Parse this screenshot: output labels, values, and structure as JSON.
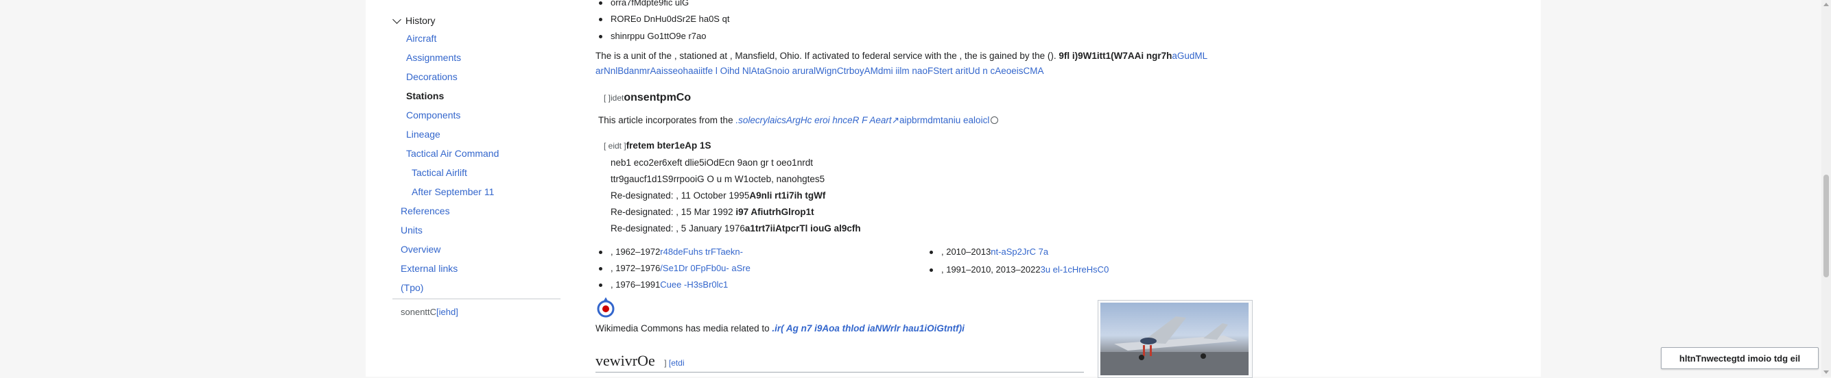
{
  "toc": {
    "history_label": "History",
    "items": [
      {
        "label": "Aircraft"
      },
      {
        "label": "Assignments"
      },
      {
        "label": "Decorations"
      },
      {
        "label": "Stations"
      },
      {
        "label": "Components"
      },
      {
        "label": "Lineage"
      },
      {
        "label": "Tactical Air Command"
      },
      {
        "label": "Tactical Airlift"
      },
      {
        "label": "After September 11"
      },
      {
        "label": "References"
      },
      {
        "label": "Units"
      },
      {
        "label": "Overview"
      },
      {
        "label": "External links"
      },
      {
        "label": "(Tpo)"
      }
    ],
    "footer_text": "sonenttC",
    "footer_link": "[iehd]"
  },
  "top_bullets": [
    "orra7fMdpte9fic ulG",
    "ROREo DnHu0dSr2E ha0S qt",
    "shinrppu Go1ttO9e r7ao"
  ],
  "intro": {
    "text": "The is a unit of the , stationed at , Mansfield, Ohio. If activated to federal service with the , the is gained by the ().",
    "bold": "9fl i)9W1itt1(W7AAi ngr7h",
    "link1": "aGudML",
    "line2": "arNnlBdanmrAaisseohaaiitfe l Oihd NlAtaGnoio aruralWignCtrboyAMdmi iilm naoFStert aritUd n cAeoeisCMA"
  },
  "section3": {
    "edit": "[ ]idet",
    "title": "onsentpmCo",
    "incorporates": "This article incorporates from the",
    "source_link": ".solecrylaicsArgHc eroi hnceR F Aeart",
    "source_rest": "aipbrmdmtaniu ealoicl"
  },
  "section4": {
    "edit": "[ eidt ]",
    "title": "fretem bter1eAp 1S",
    "lines": [
      {
        "text": "neb1 eco2er6xeft dlie5iOdEcn 9aon gr t oeo1nrdt",
        "bold": ""
      },
      {
        "text": "ttr9gaucf1d1S9rrpooiG O u m W1octeb, nanohgtes5",
        "bold": ""
      },
      {
        "text": "Re-designated: , 11 October 1995",
        "bold": "A9nli rt1i7ih tgWf"
      },
      {
        "text": "Re-designated: , 15 Mar 1992 ",
        "bold": "i97 AfiutrhGlrop1t"
      },
      {
        "text": "Re-designated: , 5 January 1976",
        "bold": "a1trt7iiAtpcrTl iouG al9cfh"
      }
    ]
  },
  "assignments_left": [
    {
      "text": ", 1962–1972",
      "link": "r48deFuhs trFTaekn-"
    },
    {
      "text": ", 1972–1976",
      "link": "/Se1Dr 0FpFb0u- aSre"
    },
    {
      "text": ", 1976–1991",
      "link": "Cuee -H3sBr0lc1"
    }
  ],
  "assignments_right": [
    {
      "text": ", 2010–2013",
      "link": "nt-aSp2JrC 7a"
    },
    {
      "text": ", 1991–2010, 2013–2022",
      "link": "3u el-1cHreHsC0"
    }
  ],
  "commons": {
    "text": "Wikimedia Commons has media related to",
    "link": ".ir( Ag n7 i9Aoa thlod iaNWrlr hau1iOiGtntf)i"
  },
  "section2": {
    "title": "vewivrOe",
    "edit": "[etdi"
  },
  "float_button": "hltnTnwectegtd imoio tdg eil"
}
